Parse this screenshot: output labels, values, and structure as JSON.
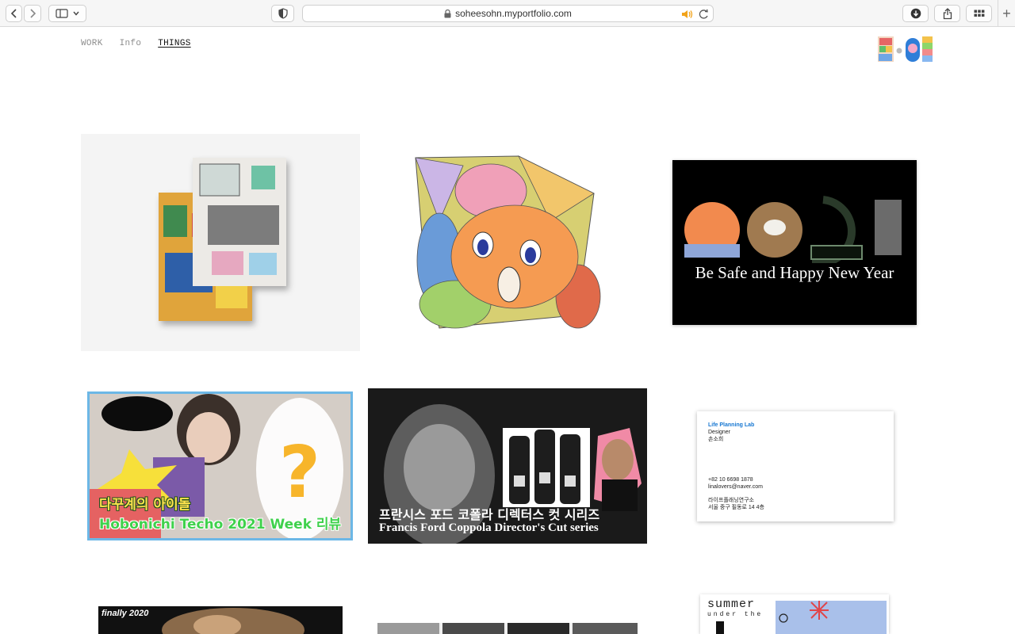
{
  "browser": {
    "url": "soheesohn.myportfolio.com",
    "new_tab": "+"
  },
  "nav": {
    "items": [
      {
        "label": "WORK",
        "active": false
      },
      {
        "label": "Info",
        "active": false
      },
      {
        "label": "THINGS",
        "active": true
      }
    ]
  },
  "projects": [
    {
      "id": "drawings-booklet"
    },
    {
      "id": "colored-pencil-character"
    },
    {
      "id": "new-year-card",
      "caption": "Be Safe and Happy New Year"
    },
    {
      "id": "hobonichi-video",
      "title_kr": "다꾸계의 아이돌",
      "title_en": "Hobonichi Techo 2021 Week 리뷰"
    },
    {
      "id": "coppola-wine",
      "title_kr": "프란시스 포드 코폴라 디렉터스 컷 시리즈",
      "title_en": "Francis Ford Coppola Director's Cut series"
    },
    {
      "id": "business-card",
      "org": "Life Planning Lab",
      "role": "Designer",
      "name": "손소희",
      "phone": "+82 10 6698 1878",
      "email": "linalovers@naver.com",
      "org_kr": "라이프플래닝연구소",
      "address": "서울 중구 필동로 14 4층"
    },
    {
      "id": "finally-2020",
      "caption": "finally 2020"
    },
    {
      "id": "grid-panels"
    },
    {
      "id": "summer-poster",
      "title": "summer",
      "subtitle": "under the"
    }
  ]
}
